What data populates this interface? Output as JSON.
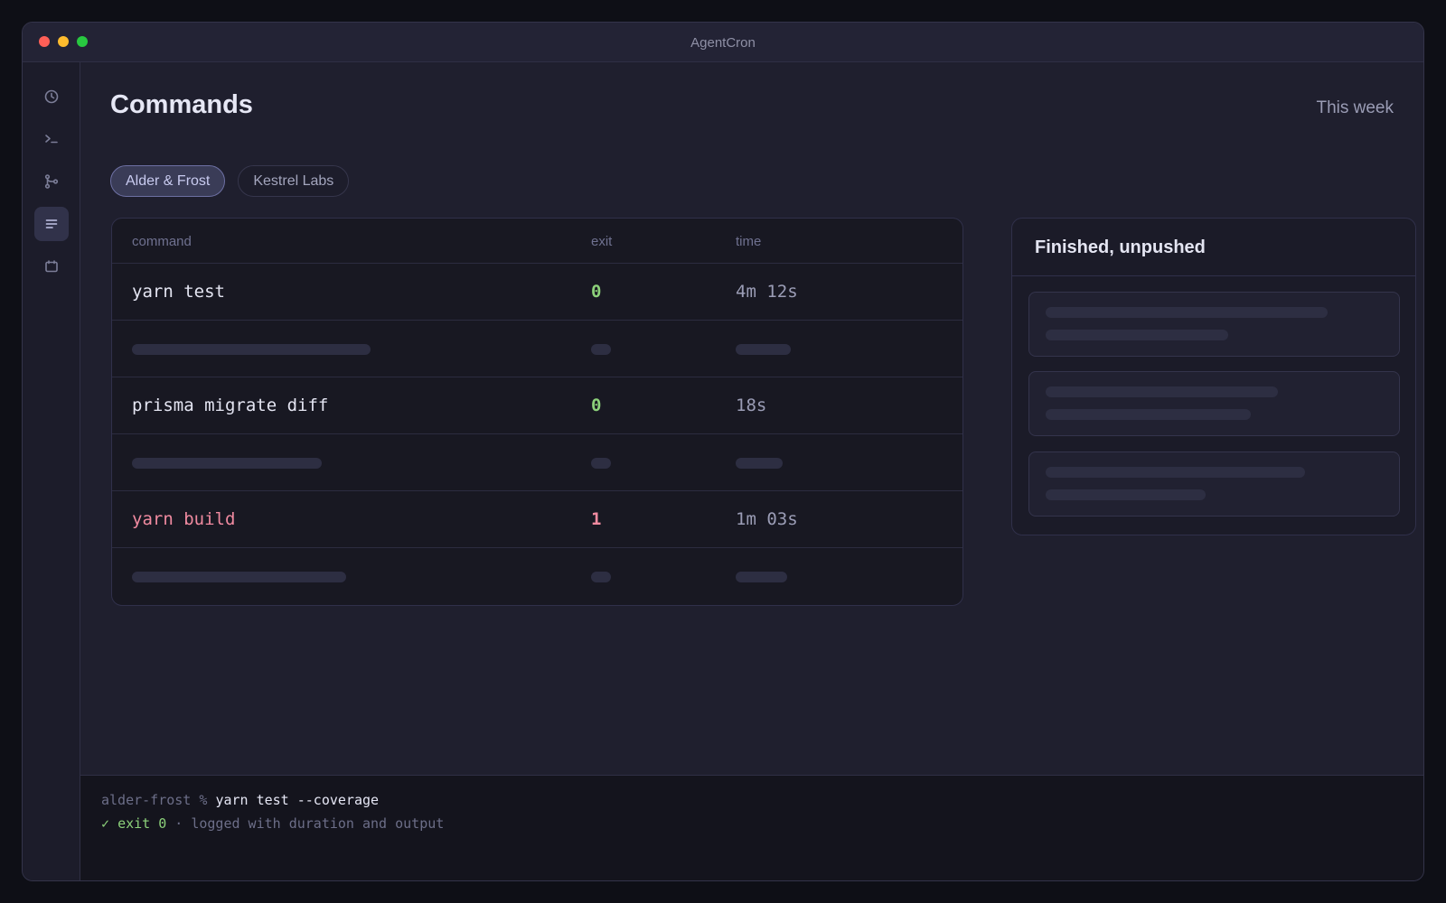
{
  "window": {
    "title": "AgentCron"
  },
  "sidebar": {
    "items": [
      {
        "icon": "clock-icon",
        "active": false
      },
      {
        "icon": "terminal-icon",
        "active": false
      },
      {
        "icon": "git-branch-icon",
        "active": false
      },
      {
        "icon": "list-icon",
        "active": true
      },
      {
        "icon": "calendar-icon",
        "active": false
      }
    ]
  },
  "header": {
    "title": "Commands",
    "range": "This week"
  },
  "tabs": [
    {
      "label": "Alder & Frost",
      "active": true
    },
    {
      "label": "Kestrel Labs",
      "active": false
    }
  ],
  "table": {
    "columns": [
      "command",
      "exit",
      "time"
    ],
    "rows": [
      {
        "command": "yarn test",
        "exit": "0",
        "time": "4m 12s",
        "status": "ok"
      },
      {
        "placeholder": true
      },
      {
        "command": "prisma migrate diff",
        "exit": "0",
        "time": "18s",
        "status": "ok"
      },
      {
        "placeholder": true
      },
      {
        "command": "yarn build",
        "exit": "1",
        "time": "1m 03s",
        "status": "fail"
      },
      {
        "placeholder": true
      }
    ]
  },
  "panel": {
    "title": "Finished, unpushed"
  },
  "console": {
    "prompt": "alder-frost %",
    "command": "yarn test --coverage",
    "result_check": "✓",
    "result_exit": "exit 0",
    "result_sep": "·",
    "result_note": "logged with duration and output"
  },
  "colors": {
    "accent": "#6d70a3",
    "success": "#8cd17a",
    "failure": "#f08aa0",
    "background": "#1f1f2e"
  }
}
